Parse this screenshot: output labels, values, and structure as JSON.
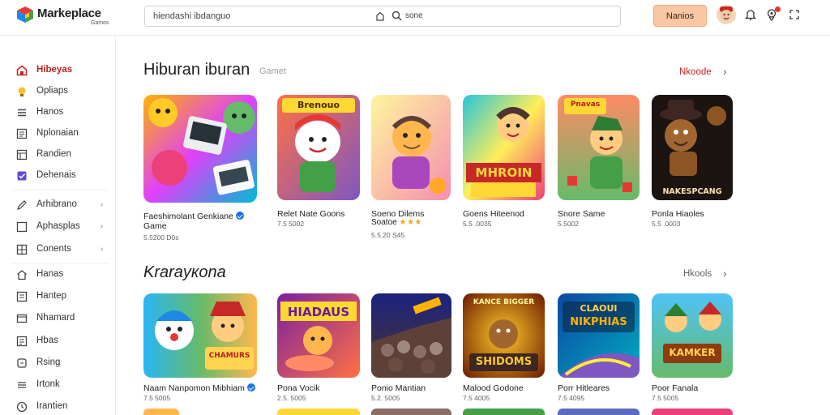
{
  "header": {
    "brand": "Markeplace",
    "brand_sub": "Gamos",
    "search_value": "hiendashi ibdanguo",
    "search_scope": "sone",
    "primary_button": "Nanios",
    "icons": [
      "marketplace-logo-icon",
      "home-icon",
      "search-icon",
      "bell-icon",
      "location-icon",
      "expand-icon"
    ]
  },
  "sidebar": {
    "items": [
      {
        "label": "Hibeyas",
        "icon": "home-icon"
      },
      {
        "label": "Opliaps",
        "icon": "bulb-icon"
      },
      {
        "label": "Hanos",
        "icon": "menu-icon"
      },
      {
        "label": "Nplonaian",
        "icon": "list-icon"
      },
      {
        "label": "Randien",
        "icon": "grid-icon"
      },
      {
        "label": "Dehenais",
        "icon": "check-icon"
      },
      {
        "label": "Arhibrano",
        "icon": "edit-icon"
      },
      {
        "label": "Aphasplas",
        "icon": "square-icon"
      },
      {
        "label": "Conents",
        "icon": "grid-icon"
      },
      {
        "label": "Hanas",
        "icon": "home-icon"
      },
      {
        "label": "Hantep",
        "icon": "list-icon"
      },
      {
        "label": "Nhamard",
        "icon": "window-icon"
      },
      {
        "label": "Hbas",
        "icon": "list-icon"
      },
      {
        "label": "Rsing",
        "icon": "tag-icon"
      },
      {
        "label": "Irtonk",
        "icon": "menu-icon"
      },
      {
        "label": "Irantien",
        "icon": "clock-icon"
      }
    ]
  },
  "sections": [
    {
      "title": "Hiburan iburan",
      "subtitle": "Gamet",
      "more": "Nkoode",
      "cards": [
        {
          "title": "Faeshimolant Genkiane",
          "title2": "Game",
          "meta": "5.5200 D0s",
          "stars": ""
        },
        {
          "title": "Relet Nate Goons",
          "title2": "",
          "meta": "7.5 5002",
          "stars": ""
        },
        {
          "title": "Soeno Dilems",
          "title2": "",
          "meta": "5.5.20 S45",
          "stars": "★★★",
          "title_prefix": "Soatoe"
        },
        {
          "title": "Goens Hiteenod",
          "title2": "",
          "meta": "5.5 .0035",
          "stars": ""
        },
        {
          "title": "Snore Same",
          "title2": "",
          "meta": "5.5002",
          "stars": ""
        },
        {
          "title": "Ponla Hiaoles",
          "title2": "",
          "meta": "5.5 .0003",
          "stars": ""
        }
      ]
    },
    {
      "title": "Krarayкona",
      "subtitle": "",
      "more": "Hkools",
      "cards": [
        {
          "title": "Naam Nanpomon Mibhiam",
          "title2": "",
          "meta": "7.5 5005",
          "stars": ""
        },
        {
          "title": "Pona Vocik",
          "title2": "",
          "meta": "2.5. 5005",
          "stars": ""
        },
        {
          "title": "Ponio Mantian",
          "title2": "",
          "meta": "5.2. 5005",
          "stars": ""
        },
        {
          "title": "Malood Godone",
          "title2": "",
          "meta": "7.5 4005",
          "stars": ""
        },
        {
          "title": "Porr Hitleares",
          "title2": "",
          "meta": "7.5 4095",
          "stars": ""
        },
        {
          "title": "Poor Fanala",
          "title2": "",
          "meta": "7.5 5005",
          "stars": ""
        }
      ]
    }
  ],
  "thumb_labels": {
    "r1c2": "Brenouo",
    "r1c4": "MHROIN",
    "r1c5": "Pnavas",
    "r1c6": "NAKESPCANG",
    "r2c2": "HIADAUS",
    "r2c4a": "KANCE BIGGER",
    "r2c4b": "SHIDOMS",
    "r2c5a": "CLAOUI",
    "r2c5b": "NIKPHIAS",
    "r2c6": "KAMKER",
    "r2c1": "CHAMURS"
  }
}
